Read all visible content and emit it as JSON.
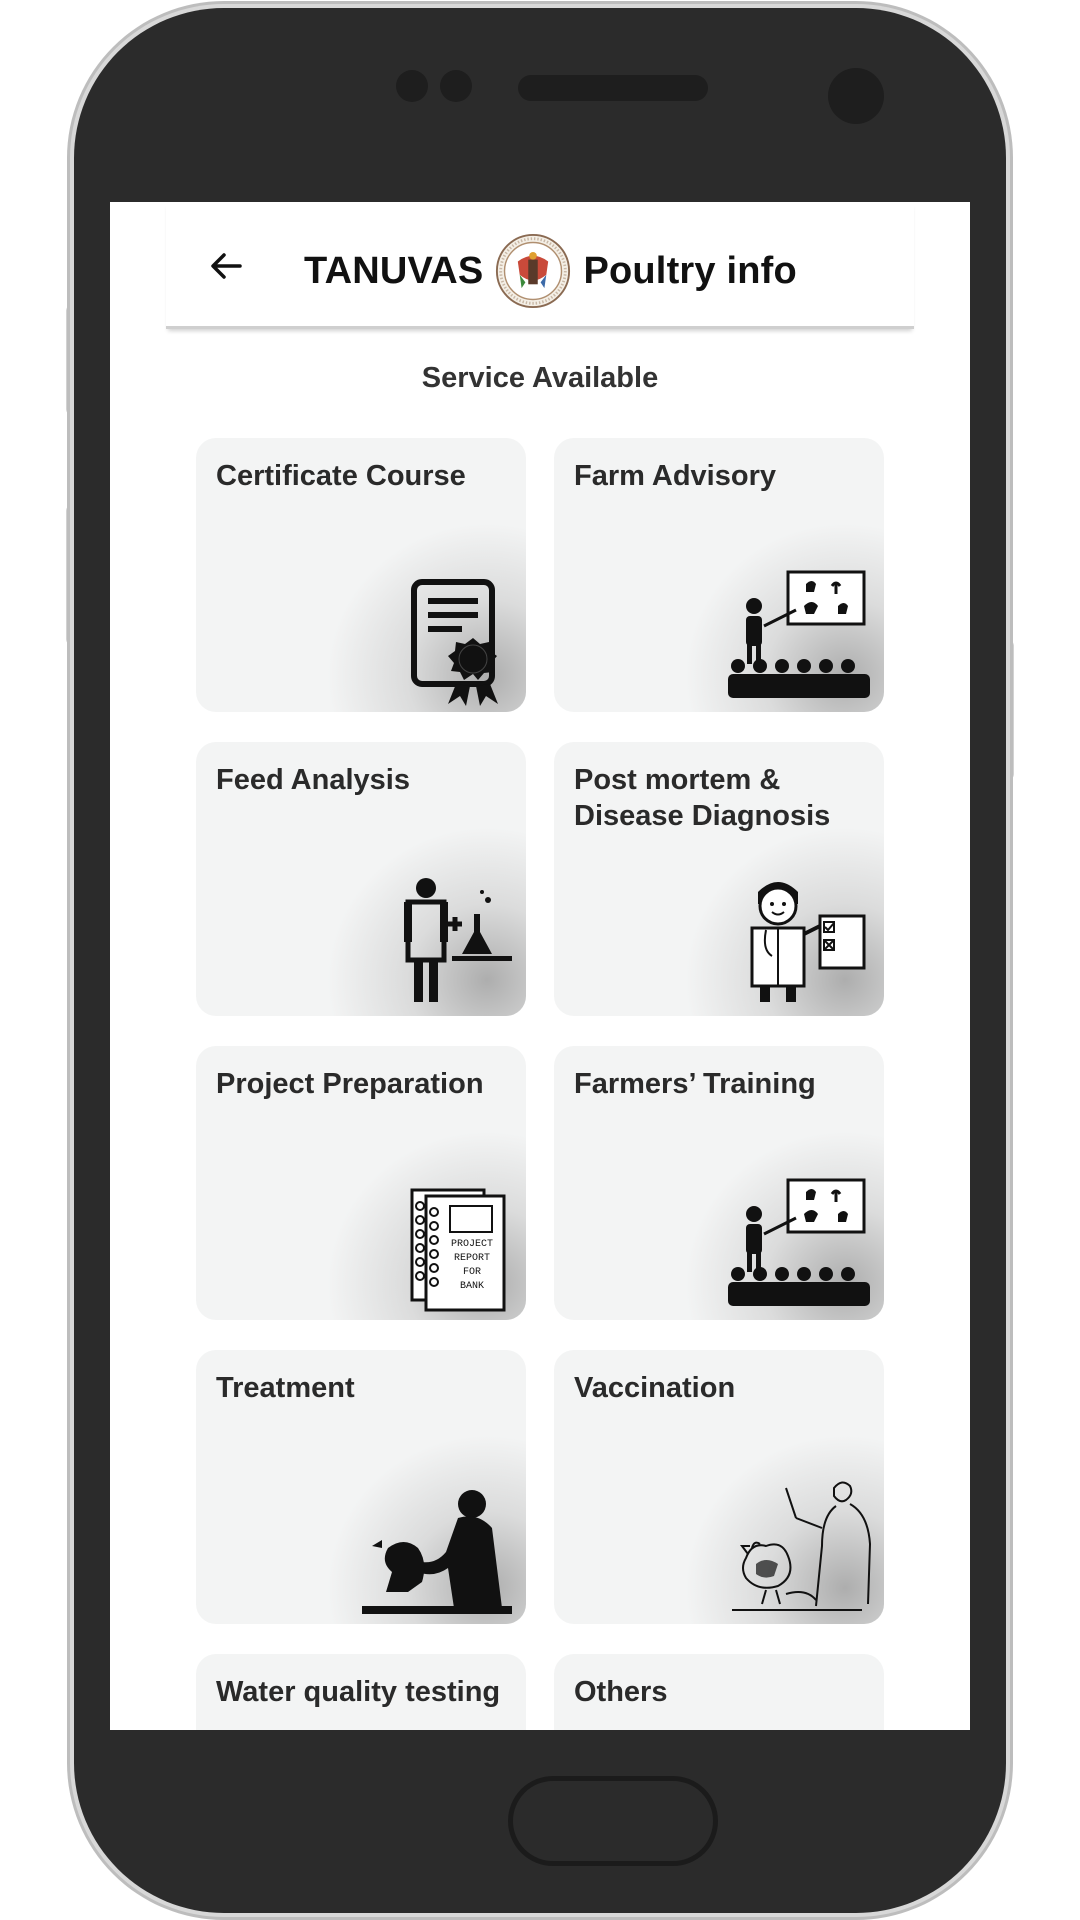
{
  "app": {
    "title_left": "TANUVAS",
    "title_right": "Poultry info",
    "back_icon": "arrow-left-icon",
    "logo_icon": "tanuvas-emblem-logo"
  },
  "section_title": "Service Available",
  "services": [
    {
      "label": "Certificate Course",
      "icon": "certificate-icon"
    },
    {
      "label": "Farm Advisory",
      "icon": "advisory-presentation-icon"
    },
    {
      "label": "Feed Analysis",
      "icon": "lab-scientist-icon"
    },
    {
      "label": "Post mortem & Disease Diagnosis",
      "icon": "doctor-checklist-icon"
    },
    {
      "label": "Project Preparation",
      "icon": "project-report-icon",
      "image_text": [
        "PROJECT",
        "REPORT",
        "FOR",
        "BANK"
      ]
    },
    {
      "label": "Farmers’ Training",
      "icon": "training-presentation-icon"
    },
    {
      "label": "Treatment",
      "icon": "vet-treatment-icon"
    },
    {
      "label": "Vaccination",
      "icon": "vaccination-icon"
    },
    {
      "label": "Water quality testing",
      "icon": "water-test-icon"
    },
    {
      "label": "Others",
      "icon": "others-icon"
    }
  ],
  "colors": {
    "card_bg": "#f3f4f4",
    "device": "#2b2b2b",
    "text": "#2a2a2a"
  }
}
